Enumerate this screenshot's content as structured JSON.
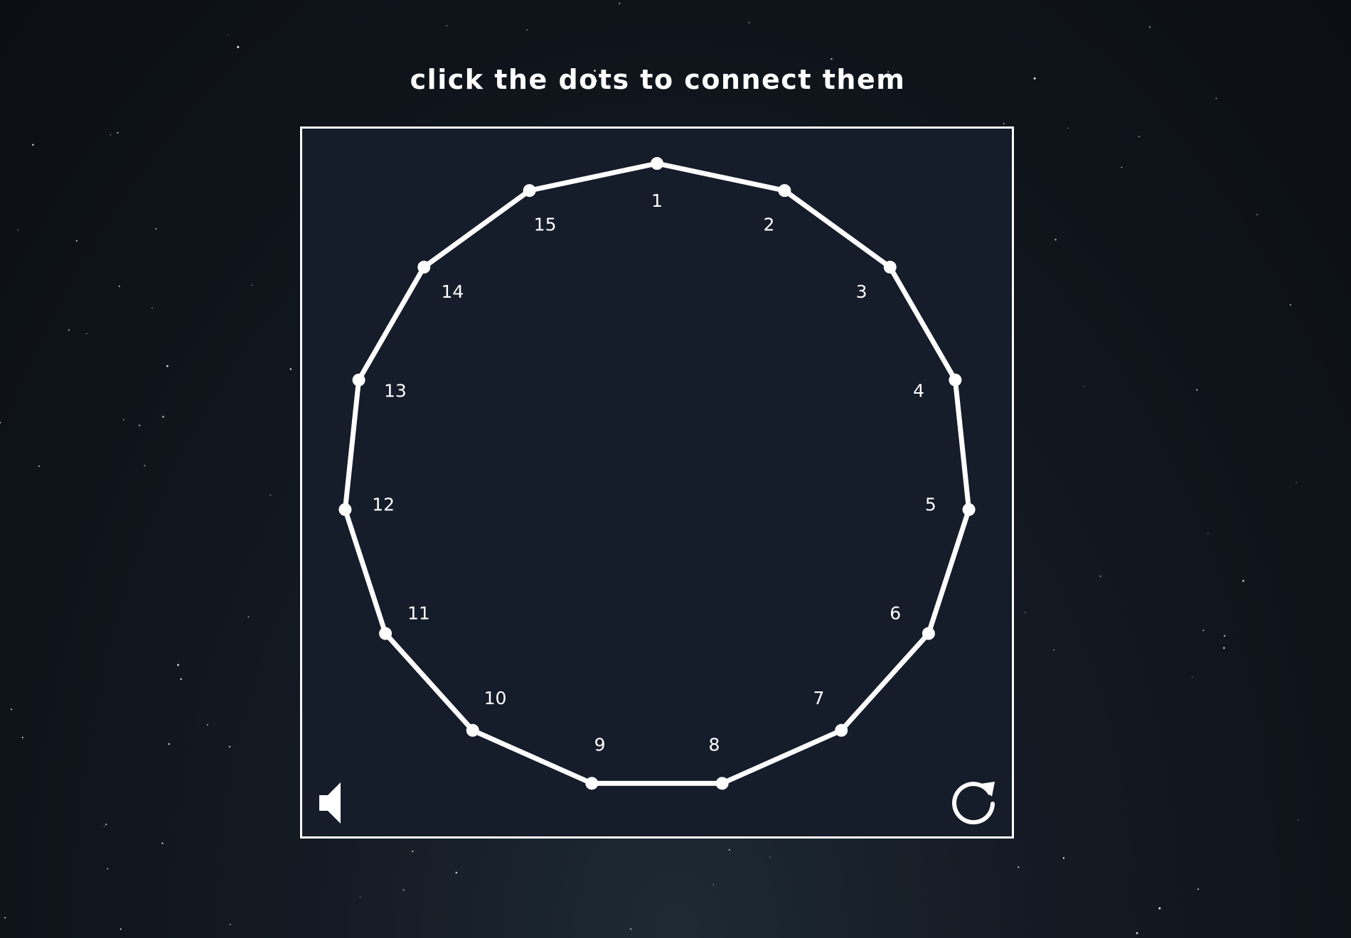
{
  "instruction": "click the dots to connect them",
  "puzzle": {
    "dots": [
      {
        "label": "1"
      },
      {
        "label": "2"
      },
      {
        "label": "3"
      },
      {
        "label": "4"
      },
      {
        "label": "5"
      },
      {
        "label": "6"
      },
      {
        "label": "7"
      },
      {
        "label": "8"
      },
      {
        "label": "9"
      },
      {
        "label": "10"
      },
      {
        "label": "11"
      },
      {
        "label": "12"
      },
      {
        "label": "13"
      },
      {
        "label": "14"
      },
      {
        "label": "15"
      }
    ],
    "line_color": "#ffffff",
    "board_color": "#151c2a"
  },
  "controls": {
    "sound_icon": "speaker-icon",
    "restart_icon": "restart-icon"
  }
}
